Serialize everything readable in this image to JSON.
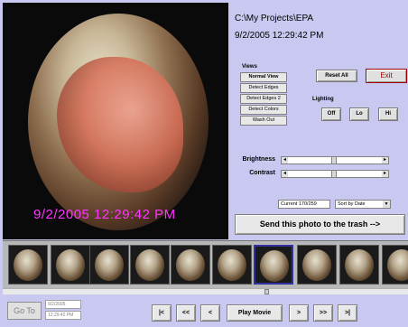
{
  "photo": {
    "timestamp_overlay": "9/2/2005  12:29:42 PM"
  },
  "header": {
    "path": "C:\\My Projects\\EPA",
    "datetime": "9/2/2005 12:29:42 PM"
  },
  "views": {
    "title": "Views",
    "buttons": [
      "Normal View",
      "Detect Edges",
      "Detect Edges 2",
      "Detect Colors",
      "Wash Out"
    ],
    "active": "Normal View"
  },
  "actions": {
    "reset_all": "Reset All",
    "exit": "Exit"
  },
  "lighting": {
    "title": "Lighting",
    "buttons": [
      "Off",
      "Lo",
      "Hi"
    ]
  },
  "adjust": {
    "brightness_label": "Brightness",
    "contrast_label": "Contrast"
  },
  "status": {
    "current": "Current 170/259",
    "sort_option": "Sort by Date"
  },
  "trash_button": "Send this photo to the trash -->",
  "thumbnails": {
    "count": 9,
    "selected_index": 5
  },
  "navigation": {
    "goto_label": "Go To",
    "goto_date": "9/2/2005",
    "goto_time": "12:29:42 PM",
    "first": "|<",
    "prev_fast": "<<",
    "prev": "<",
    "play": "Play Movie",
    "next": ">",
    "next_fast": ">>",
    "last": ">|"
  },
  "colors": {
    "background": "#c8c8f0",
    "timestamp_overlay": "#ff33ff",
    "exit_text": "#a00000"
  }
}
